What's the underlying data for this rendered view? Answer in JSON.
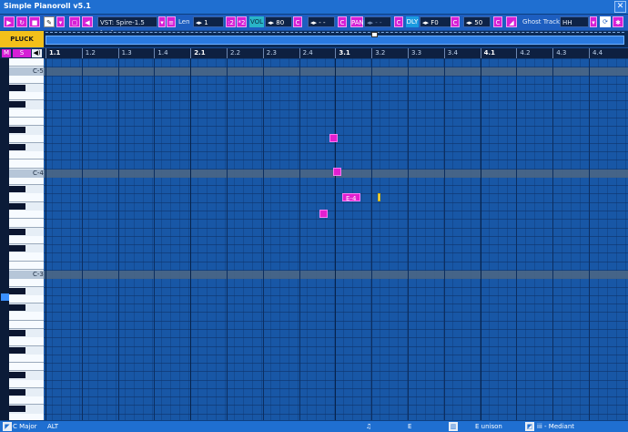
{
  "window": {
    "title": "Simple Pianoroll v5.1",
    "close": "✕"
  },
  "toolbar": {
    "vst_label": "VST: Spire-1.5 [05]",
    "len_label": "Len",
    "len_value": "1",
    "div2": ":2",
    "mul2": "*2",
    "vol_label": "VOL",
    "vol_value": "80",
    "c1": "C",
    "vol_dash": "- -",
    "c2": "C",
    "pan_label": "PAN",
    "pan_value": "- -",
    "c3": "C",
    "key_label": "DLY",
    "key_value": "F0",
    "c4": "C",
    "dly_value": "50",
    "c5": "C",
    "ghost_label": "Ghost Track",
    "ghost_value": "HH"
  },
  "track": {
    "name": "PLUCK",
    "mute": "M",
    "solo": "S",
    "speaker": "◀)"
  },
  "ruler": {
    "bars": [
      "1.1",
      "1.2",
      "1.3",
      "1.4",
      "2.1",
      "2.2",
      "2.3",
      "2.4",
      "3.1",
      "3.2",
      "3.3",
      "3.4",
      "4.1",
      "4.2",
      "4.3",
      "4.4"
    ],
    "major": [
      "1.1",
      "2.1",
      "3.1",
      "4.1"
    ]
  },
  "keyboard": {
    "labels": [
      "C-5",
      "C-4",
      "C-3"
    ]
  },
  "notes": [
    {
      "label": ""
    },
    {
      "label": ""
    },
    {
      "label": "E-4"
    },
    {
      "label": ""
    }
  ],
  "status": {
    "scale": "C Major",
    "modifier": "ALT",
    "note": "E",
    "chord": "E unison",
    "degree": "iii - Mediant"
  },
  "colors": {
    "accent": "#d61fd6",
    "track": "#f3c01a",
    "grid": "#1857a6"
  }
}
